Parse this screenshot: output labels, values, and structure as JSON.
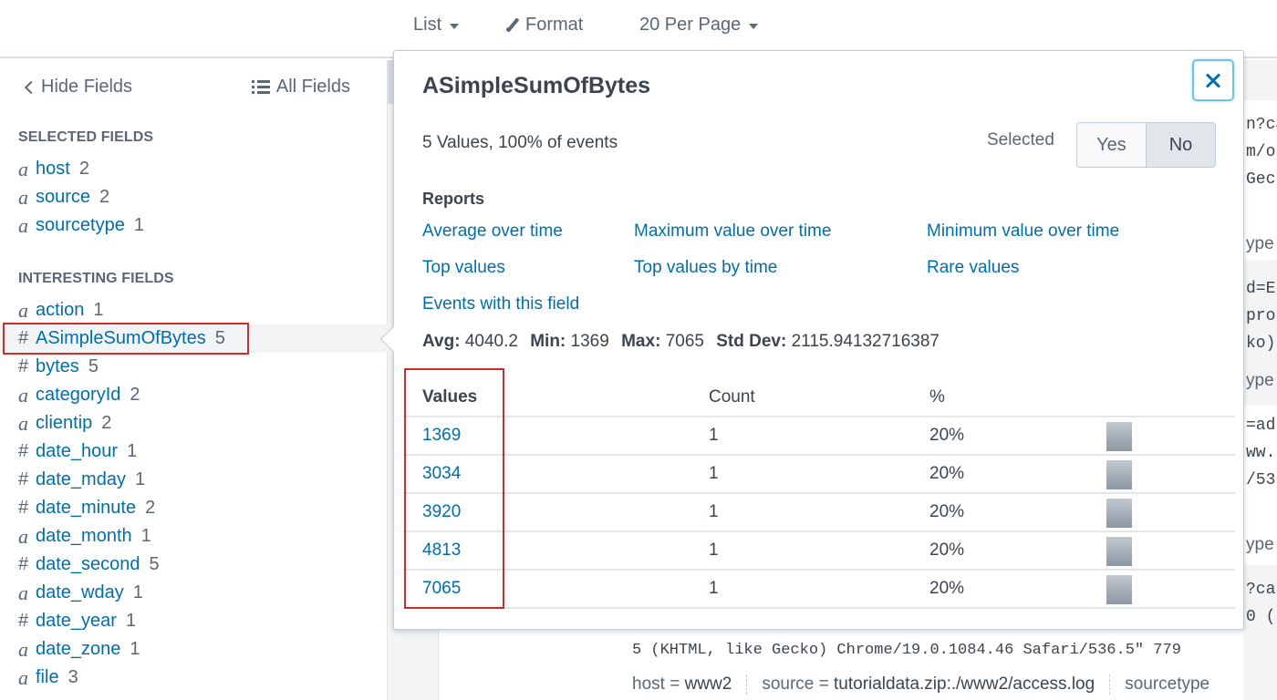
{
  "toolbar": {
    "list_label": "List",
    "format_label": "Format",
    "per_page_label": "20 Per Page"
  },
  "sidebar": {
    "hide_fields_label": "Hide Fields",
    "all_fields_label": "All Fields",
    "selected_title": "SELECTED FIELDS",
    "selected_fields": [
      {
        "type": "a",
        "name": "host",
        "count": "2"
      },
      {
        "type": "a",
        "name": "source",
        "count": "2"
      },
      {
        "type": "a",
        "name": "sourcetype",
        "count": "1"
      }
    ],
    "interesting_title": "INTERESTING FIELDS",
    "interesting_fields": [
      {
        "type": "a",
        "name": "action",
        "count": "1"
      },
      {
        "type": "#",
        "name": "ASimpleSumOfBytes",
        "count": "5",
        "active": true
      },
      {
        "type": "#",
        "name": "bytes",
        "count": "5"
      },
      {
        "type": "a",
        "name": "categoryId",
        "count": "2"
      },
      {
        "type": "a",
        "name": "clientip",
        "count": "2"
      },
      {
        "type": "#",
        "name": "date_hour",
        "count": "1"
      },
      {
        "type": "#",
        "name": "date_mday",
        "count": "1"
      },
      {
        "type": "#",
        "name": "date_minute",
        "count": "2"
      },
      {
        "type": "a",
        "name": "date_month",
        "count": "1"
      },
      {
        "type": "#",
        "name": "date_second",
        "count": "5"
      },
      {
        "type": "a",
        "name": "date_wday",
        "count": "1"
      },
      {
        "type": "#",
        "name": "date_year",
        "count": "1"
      },
      {
        "type": "a",
        "name": "date_zone",
        "count": "1"
      },
      {
        "type": "a",
        "name": "file",
        "count": "3"
      }
    ]
  },
  "popover": {
    "title": "ASimpleSumOfBytes",
    "summary": "5 Values, 100% of events",
    "selected_label": "Selected",
    "selected_yes": "Yes",
    "selected_no": "No",
    "selected_value": "No",
    "reports_title": "Reports",
    "reports": [
      "Average over time",
      "Maximum value over time",
      "Minimum value over time",
      "Top values",
      "Top values by time",
      "Rare values",
      "Events with this field"
    ],
    "stats": {
      "avg_label": "Avg:",
      "avg": "4040.2",
      "min_label": "Min:",
      "min": "1369",
      "max_label": "Max:",
      "max": "7065",
      "std_label": "Std Dev:",
      "std": "2115.94132716387"
    },
    "table": {
      "headers": [
        "Values",
        "Count",
        "%"
      ],
      "rows": [
        {
          "value": "1369",
          "count": "1",
          "percent": "20%",
          "fraction": 0.2
        },
        {
          "value": "3034",
          "count": "1",
          "percent": "20%",
          "fraction": 0.2
        },
        {
          "value": "3920",
          "count": "1",
          "percent": "20%",
          "fraction": 0.2
        },
        {
          "value": "4813",
          "count": "1",
          "percent": "20%",
          "fraction": 0.2
        },
        {
          "value": "7065",
          "count": "1",
          "percent": "20%",
          "fraction": 0.2
        }
      ]
    }
  },
  "events": {
    "right_fragments": [
      "n?ca",
      "m/o",
      "Gec",
      "ype",
      "d=E",
      "pro",
      "ko)",
      "ype",
      "=ad",
      "ww.",
      "/53",
      "ype",
      "?ca",
      "0 ("
    ],
    "raw_line": "5 (KHTML, like Gecko) Chrome/19.0.1084.46 Safari/536.5\" 779",
    "fields": [
      {
        "key": "host",
        "value": "www2"
      },
      {
        "key": "source",
        "value": "tutorialdata.zip:./www2/access.log"
      },
      {
        "key": "sourcetype",
        "value": ""
      }
    ]
  },
  "colors": {
    "link": "#006eaa",
    "highlight": "#d12b2b",
    "focus": "#6fc1f5"
  }
}
